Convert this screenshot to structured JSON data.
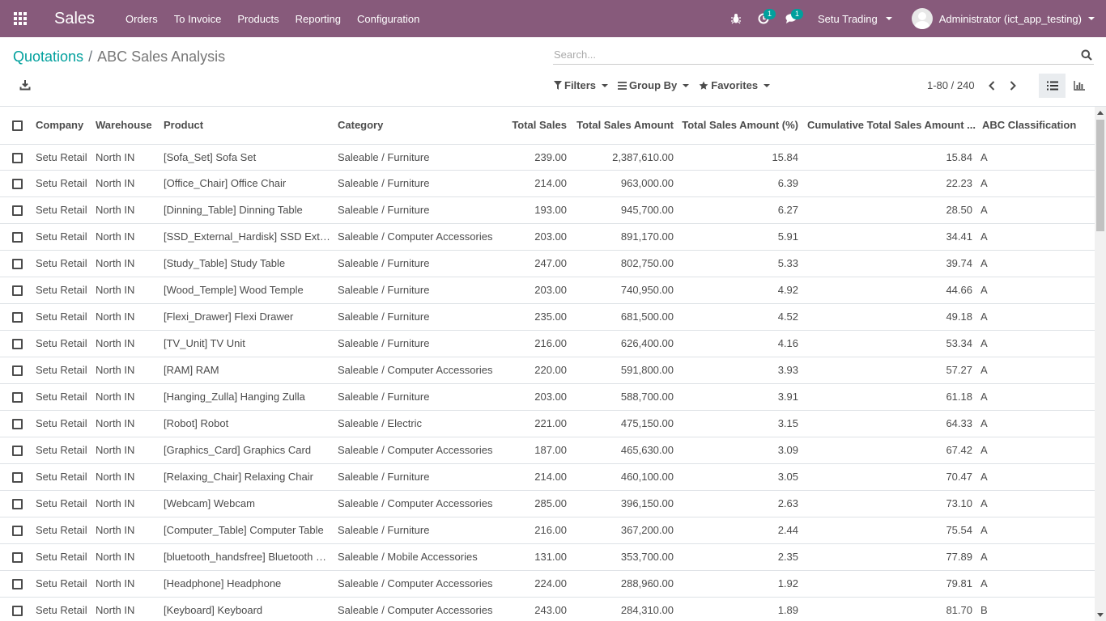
{
  "navbar": {
    "app_name": "Sales",
    "menu": [
      "Orders",
      "To Invoice",
      "Products",
      "Reporting",
      "Configuration"
    ],
    "activity_count": "1",
    "message_count": "1",
    "company": "Setu Trading",
    "user": "Administrator (ict_app_testing)",
    "accent_color": "#875a7b"
  },
  "control": {
    "breadcrumb_parent": "Quotations",
    "breadcrumb_current": "ABC Sales Analysis",
    "search_placeholder": "Search...",
    "filters_label": "Filters",
    "groupby_label": "Group By",
    "favorites_label": "Favorites",
    "pager": "1-80 / 240"
  },
  "table": {
    "headers": [
      "Company",
      "Warehouse",
      "Product",
      "Category",
      "Total Sales",
      "Total Sales Amount",
      "Total Sales Amount (%)",
      "Cumulative Total Sales Amount ...",
      "ABC Classification"
    ],
    "rows": [
      [
        "Setu Retail",
        "North IN",
        "[Sofa_Set] Sofa Set",
        "Saleable / Furniture",
        "239.00",
        "2,387,610.00",
        "15.84",
        "15.84",
        "A"
      ],
      [
        "Setu Retail",
        "North IN",
        "[Office_Chair] Office Chair",
        "Saleable / Furniture",
        "214.00",
        "963,000.00",
        "6.39",
        "22.23",
        "A"
      ],
      [
        "Setu Retail",
        "North IN",
        "[Dinning_Table] Dinning Table",
        "Saleable / Furniture",
        "193.00",
        "945,700.00",
        "6.27",
        "28.50",
        "A"
      ],
      [
        "Setu Retail",
        "North IN",
        "[SSD_External_Hardisk] SSD External Hardisk",
        "Saleable / Computer Accessories",
        "203.00",
        "891,170.00",
        "5.91",
        "34.41",
        "A"
      ],
      [
        "Setu Retail",
        "North IN",
        "[Study_Table] Study Table",
        "Saleable / Furniture",
        "247.00",
        "802,750.00",
        "5.33",
        "39.74",
        "A"
      ],
      [
        "Setu Retail",
        "North IN",
        "[Wood_Temple] Wood Temple",
        "Saleable / Furniture",
        "203.00",
        "740,950.00",
        "4.92",
        "44.66",
        "A"
      ],
      [
        "Setu Retail",
        "North IN",
        "[Flexi_Drawer] Flexi Drawer",
        "Saleable / Furniture",
        "235.00",
        "681,500.00",
        "4.52",
        "49.18",
        "A"
      ],
      [
        "Setu Retail",
        "North IN",
        "[TV_Unit] TV Unit",
        "Saleable / Furniture",
        "216.00",
        "626,400.00",
        "4.16",
        "53.34",
        "A"
      ],
      [
        "Setu Retail",
        "North IN",
        "[RAM] RAM",
        "Saleable / Computer Accessories",
        "220.00",
        "591,800.00",
        "3.93",
        "57.27",
        "A"
      ],
      [
        "Setu Retail",
        "North IN",
        "[Hanging_Zulla] Hanging Zulla",
        "Saleable / Furniture",
        "203.00",
        "588,700.00",
        "3.91",
        "61.18",
        "A"
      ],
      [
        "Setu Retail",
        "North IN",
        "[Robot] Robot",
        "Saleable / Electric",
        "221.00",
        "475,150.00",
        "3.15",
        "64.33",
        "A"
      ],
      [
        "Setu Retail",
        "North IN",
        "[Graphics_Card] Graphics Card",
        "Saleable / Computer Accessories",
        "187.00",
        "465,630.00",
        "3.09",
        "67.42",
        "A"
      ],
      [
        "Setu Retail",
        "North IN",
        "[Relaxing_Chair] Relaxing Chair",
        "Saleable / Furniture",
        "214.00",
        "460,100.00",
        "3.05",
        "70.47",
        "A"
      ],
      [
        "Setu Retail",
        "North IN",
        "[Webcam] Webcam",
        "Saleable / Computer Accessories",
        "285.00",
        "396,150.00",
        "2.63",
        "73.10",
        "A"
      ],
      [
        "Setu Retail",
        "North IN",
        "[Computer_Table] Computer Table",
        "Saleable / Furniture",
        "216.00",
        "367,200.00",
        "2.44",
        "75.54",
        "A"
      ],
      [
        "Setu Retail",
        "North IN",
        "[bluetooth_handsfree] Bluetooth Handsfree",
        "Saleable / Mobile Accessories",
        "131.00",
        "353,700.00",
        "2.35",
        "77.89",
        "A"
      ],
      [
        "Setu Retail",
        "North IN",
        "[Headphone] Headphone",
        "Saleable / Computer Accessories",
        "224.00",
        "288,960.00",
        "1.92",
        "79.81",
        "A"
      ],
      [
        "Setu Retail",
        "North IN",
        "[Keyboard] Keyboard",
        "Saleable / Computer Accessories",
        "243.00",
        "284,310.00",
        "1.89",
        "81.70",
        "B"
      ]
    ]
  }
}
